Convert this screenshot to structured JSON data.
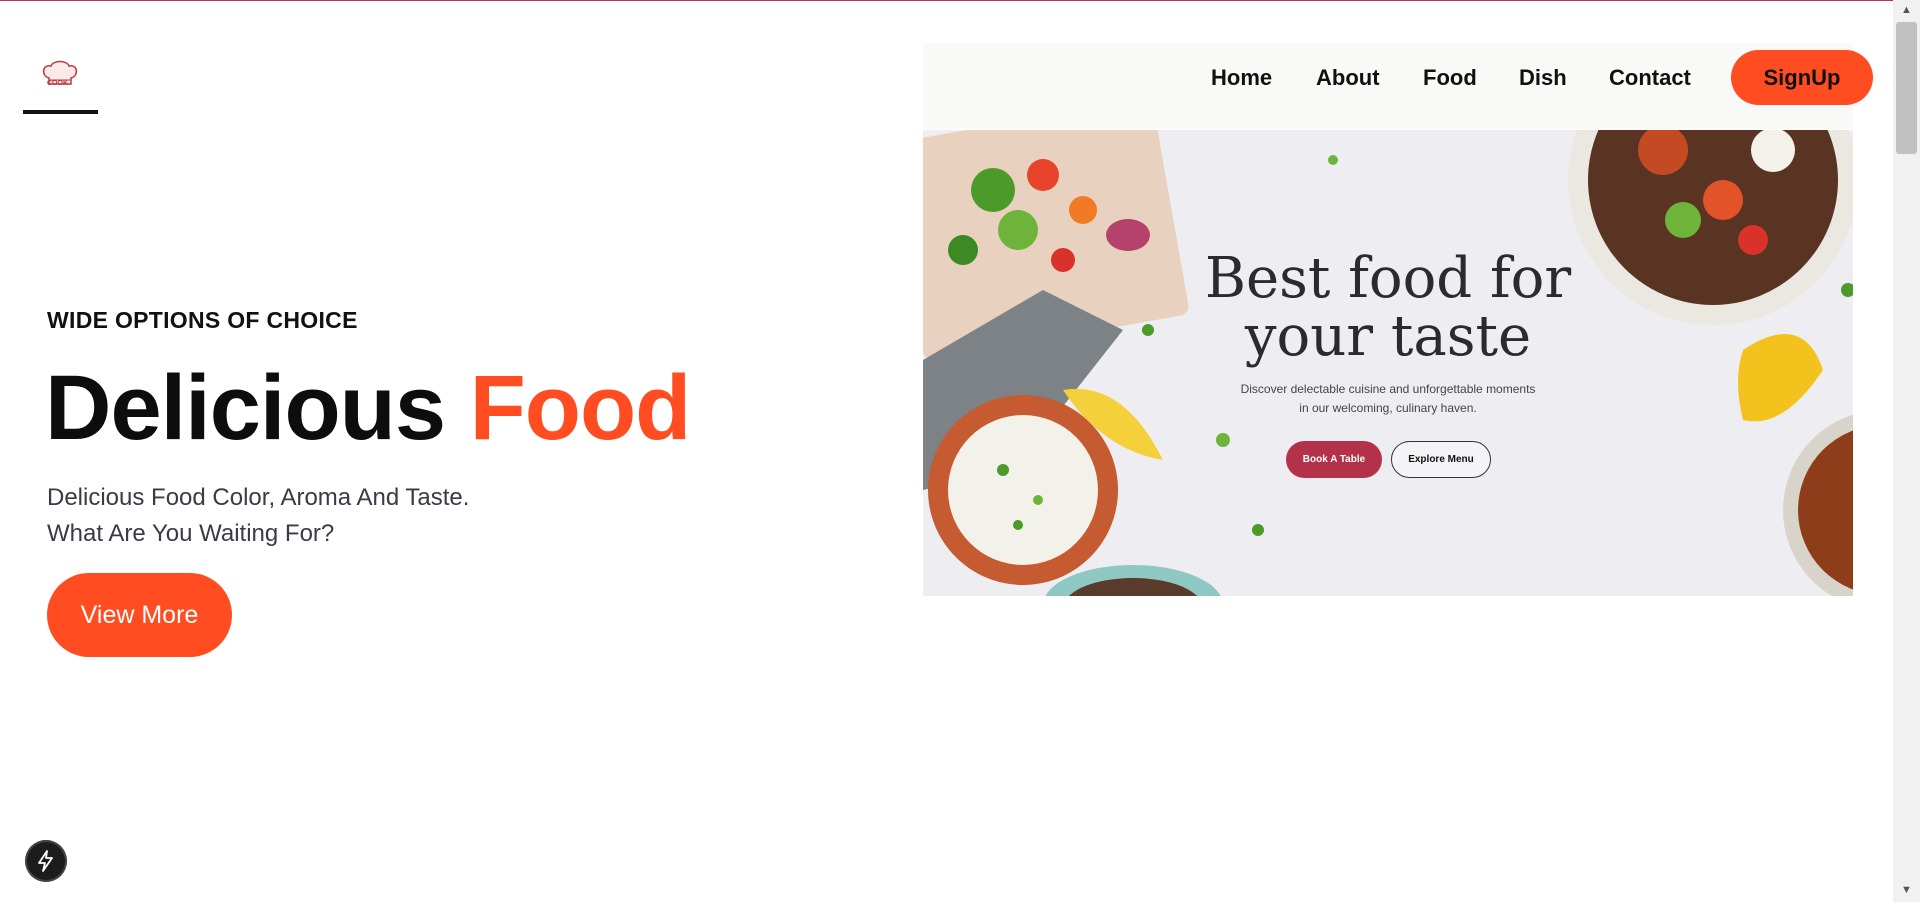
{
  "logo": {
    "text": "COOK",
    "icon": "chef-hat-icon"
  },
  "nav": {
    "items": [
      "Home",
      "About",
      "Food",
      "Dish",
      "Contact"
    ],
    "signup_label": "SignUp"
  },
  "hero": {
    "tagline": "WIDE OPTIONS OF CHOICE",
    "title_main": "Delicious",
    "title_accent": "Food",
    "subtitle_line1": "Delicious Food Color, Aroma And Taste.",
    "subtitle_line2": "What Are You Waiting For?",
    "cta_label": "View More"
  },
  "banner": {
    "title_line1": "Best food for",
    "title_line2": "your taste",
    "subtitle_line1": "Discover delectable cuisine and unforgettable moments",
    "subtitle_line2": "in our welcoming, culinary haven.",
    "primary_button": "Book A Table",
    "secondary_button": "Explore Menu"
  },
  "dev_badge": {
    "icon": "lightning-icon"
  },
  "colors": {
    "accent": "#ff4d21",
    "banner_button": "#b3324a",
    "nav_bg": "#f9f9f7"
  }
}
